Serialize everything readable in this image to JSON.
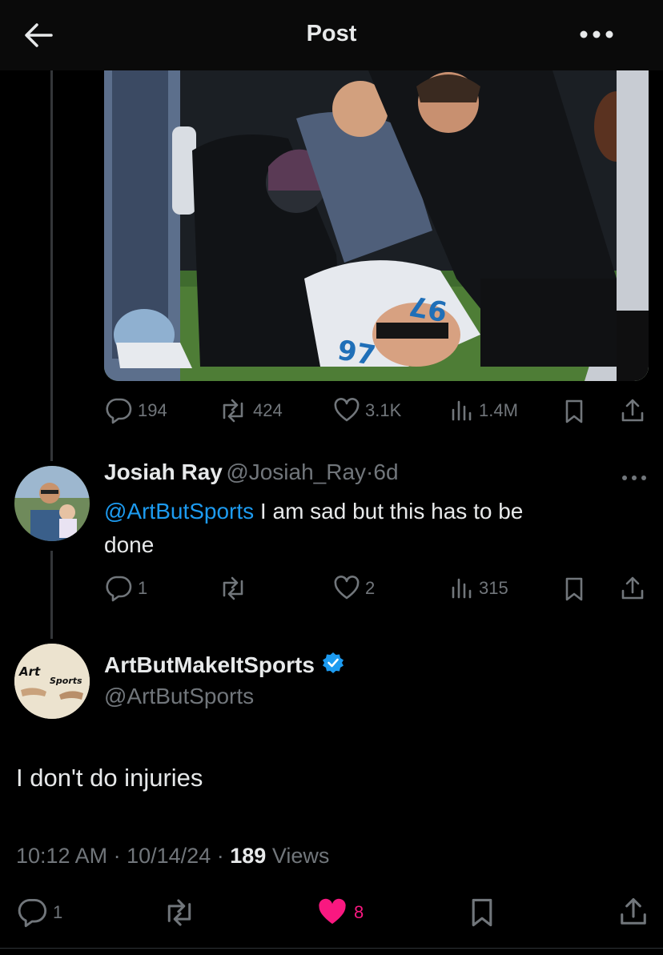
{
  "header": {
    "title": "Post"
  },
  "parent_post": {
    "stats": {
      "replies": "194",
      "reposts": "424",
      "likes": "3.1K",
      "views": "1.4M"
    }
  },
  "reply": {
    "display_name": "Josiah Ray",
    "handle": "@Josiah_Ray",
    "separator": "·",
    "time_ago": "6d",
    "mention": "@ArtButSports",
    "text_line1": " I am sad but this has to be",
    "text_line2": "done",
    "stats": {
      "replies": "1",
      "reposts": "",
      "likes": "2",
      "views": "315"
    }
  },
  "main_post": {
    "display_name": "ArtButMakeItSports",
    "handle": "@ArtButSports",
    "avatar_text_left": "Art",
    "avatar_text_right": "Sports",
    "text": "I don't do injuries",
    "time": "10:12 AM",
    "sep1": "·",
    "date": "10/14/24",
    "sep2": "·",
    "views_count": "189",
    "views_label": "Views",
    "stats": {
      "replies": "1",
      "likes": "8"
    },
    "liked": true,
    "like_color": "#f91880"
  },
  "colors": {
    "accent": "#1d9bf0",
    "verified": "#1d9bf0",
    "muted": "#71767b"
  }
}
